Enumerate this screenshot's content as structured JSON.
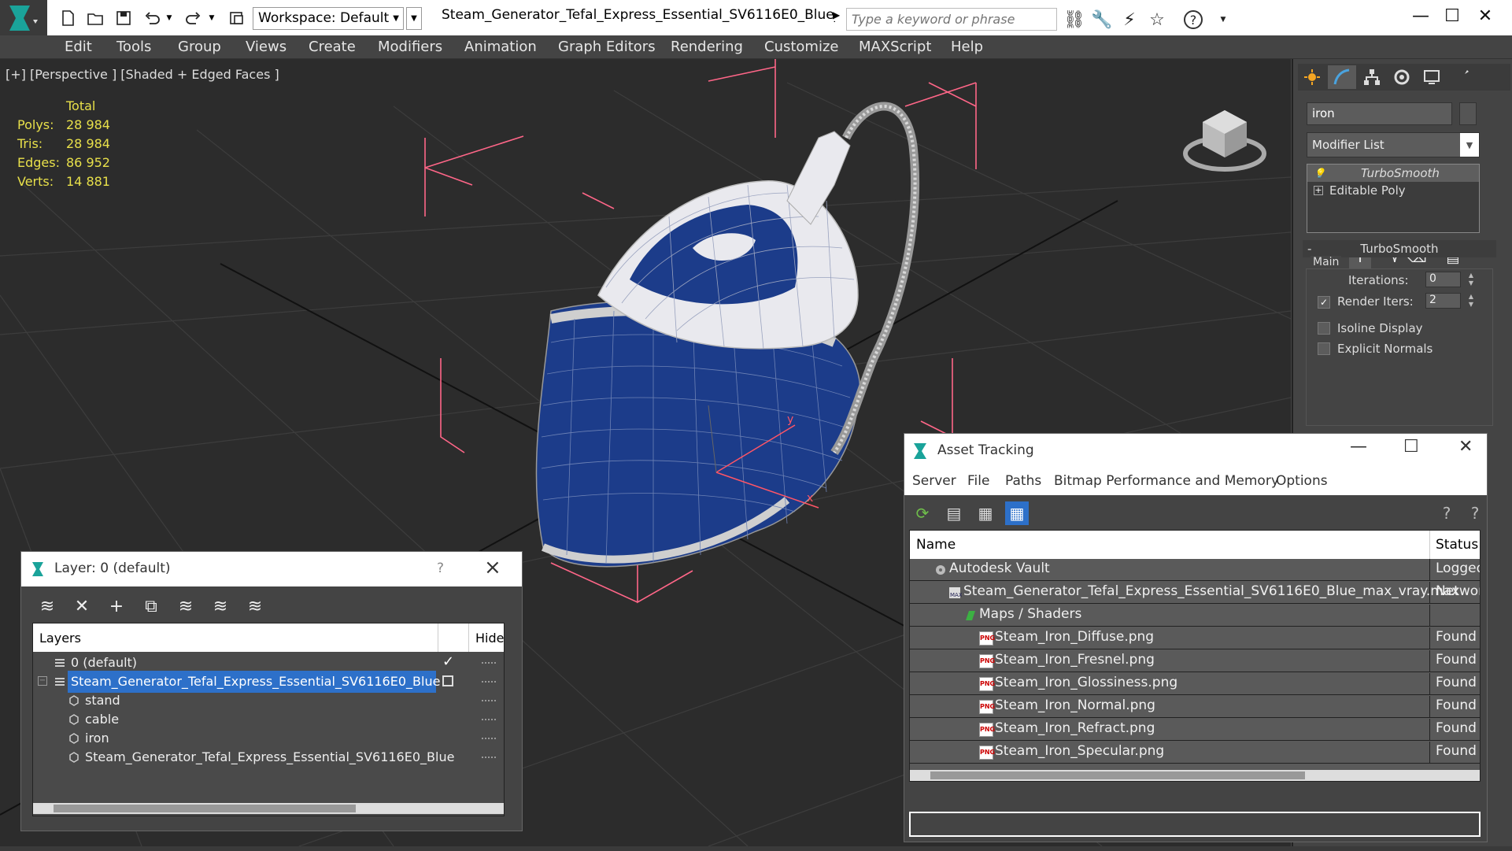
{
  "titlebar": {
    "workspace": "Workspace: Default",
    "document_title": "Steam_Generator_Tefal_Express_Essential_SV6116E0_Blue_ma...",
    "search_placeholder": "Type a keyword or phrase"
  },
  "menu": [
    "Edit",
    "Tools",
    "Group",
    "Views",
    "Create",
    "Modifiers",
    "Animation",
    "Graph Editors",
    "Rendering",
    "Customize",
    "MAXScript",
    "Help"
  ],
  "viewport": {
    "label": "[+] [Perspective ] [Shaded + Edged Faces ]",
    "stats": {
      "header": "Total",
      "rows": [
        {
          "key": "Polys:",
          "value": "28 984"
        },
        {
          "key": "Tris:",
          "value": "28 984"
        },
        {
          "key": "Edges:",
          "value": "86 952"
        },
        {
          "key": "Verts:",
          "value": "14 881"
        }
      ]
    },
    "colors": {
      "stats": "#e8e04a",
      "selection_bracket": "#ff6688",
      "model_blue": "#1c3c8a"
    }
  },
  "command_panel": {
    "object_name": "iron",
    "modifier_list": "Modifier List",
    "stack": [
      "TurboSmooth",
      "Editable Poly"
    ],
    "rollout_title": "TurboSmooth",
    "group_label": "Main",
    "iterations_label": "Iterations:",
    "iterations_value": "0",
    "render_iters_label": "Render Iters:",
    "render_iters_value": "2",
    "isoline_label": "Isoline Display",
    "explicit_label": "Explicit Normals"
  },
  "layer_window": {
    "title": "Layer: 0 (default)",
    "help": "?",
    "col_layers": "Layers",
    "col_hide": "Hide",
    "rows": [
      {
        "name": "0 (default)",
        "level": 0
      },
      {
        "name": "Steam_Generator_Tefal_Express_Essential_SV6116E0_Blue",
        "level": 0
      },
      {
        "name": "stand",
        "level": 1
      },
      {
        "name": "cable",
        "level": 1
      },
      {
        "name": "iron",
        "level": 1
      },
      {
        "name": "Steam_Generator_Tefal_Express_Essential_SV6116E0_Blue",
        "level": 1
      }
    ]
  },
  "asset_window": {
    "title": "Asset Tracking",
    "menu": [
      "Server",
      "File",
      "Paths",
      "Bitmap Performance and Memory",
      "Options"
    ],
    "col_name": "Name",
    "col_status": "Status",
    "rows": [
      {
        "name": "Autodesk Vault",
        "status": "Logged",
        "indent": 0
      },
      {
        "name": "Steam_Generator_Tefal_Express_Essential_SV6116E0_Blue_max_vray.max",
        "status": "Network",
        "indent": 1
      },
      {
        "name": "Maps / Shaders",
        "status": "",
        "indent": 2
      },
      {
        "name": "Steam_Iron_Diffuse.png",
        "status": "Found",
        "indent": 3
      },
      {
        "name": "Steam_Iron_Fresnel.png",
        "status": "Found",
        "indent": 3
      },
      {
        "name": "Steam_Iron_Glossiness.png",
        "status": "Found",
        "indent": 3
      },
      {
        "name": "Steam_Iron_Normal.png",
        "status": "Found",
        "indent": 3
      },
      {
        "name": "Steam_Iron_Refract.png",
        "status": "Found",
        "indent": 3
      },
      {
        "name": "Steam_Iron_Specular.png",
        "status": "Found",
        "indent": 3
      }
    ],
    "png_badge": "PNG"
  }
}
